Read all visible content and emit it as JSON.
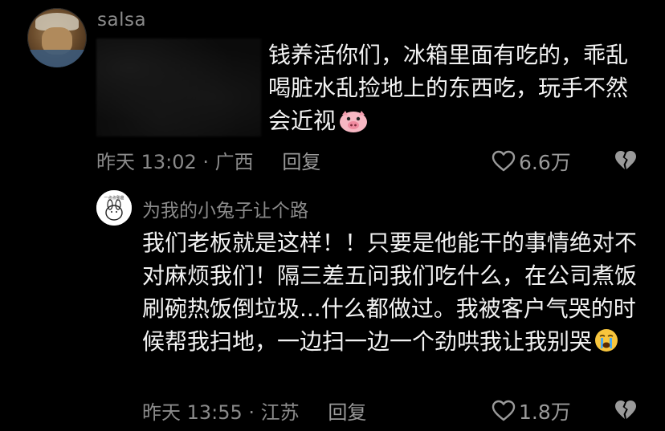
{
  "top_comment": {
    "username": "salsa",
    "text": "钱养活你们，冰箱里面有吃的，乖乱喝脏水乱捡地上的东西吃，玩手不然会近视",
    "time_location": "昨天 13:02 · 广西",
    "reply_label": "回复",
    "likes": "6.6万"
  },
  "reply_comment": {
    "username": "为我的小兔子让个路",
    "avatar_text": "一点点我爸",
    "text": "我们老板就是这样！！只要是他能干的事情绝对不对麻烦我们！隔三差五问我们吃什么，在公司煮饭刷碗热饭倒垃圾...什么都做过。我被客户气哭的时候帮我扫地，一边扫一边一个劲哄我让我别哭",
    "time_location": "昨天 13:55 · 江苏",
    "reply_label": "回复",
    "likes": "1.8万"
  },
  "icons": {
    "like": "heart-outline-icon",
    "dislike": "broken-heart-icon",
    "pig_emoji": "pig-face-emoji",
    "cry_emoji": "crying-face-emoji"
  },
  "colors": {
    "background": "#000000",
    "text_primary": "#f2f2f2",
    "text_secondary": "#8a8a8a"
  }
}
